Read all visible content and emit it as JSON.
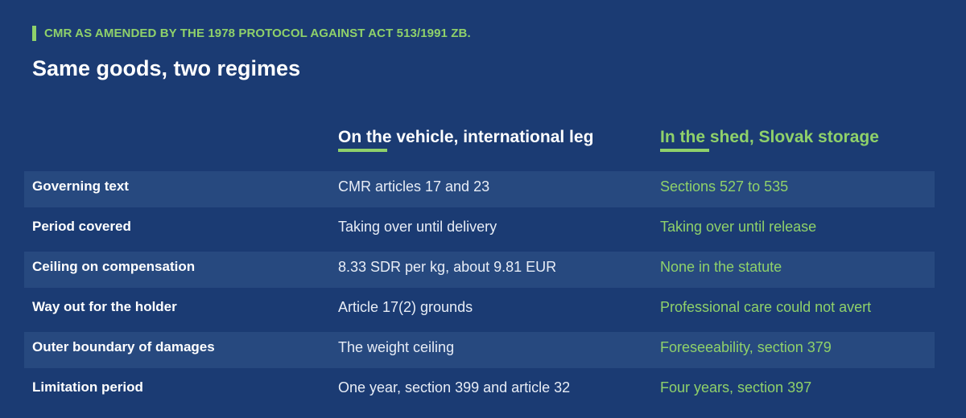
{
  "kicker": "CMR AS AMENDED BY THE 1978 PROTOCOL AGAINST ACT 513/1991 ZB.",
  "title": "Same goods, two regimes",
  "columns": {
    "vehicle": "On the vehicle, international leg",
    "shed": "In the shed, Slovak storage"
  },
  "colors": {
    "background": "#1b3b73",
    "row_shade": "#27497f",
    "accent": "#8fd16a"
  },
  "rows": [
    {
      "label": "Governing text",
      "vehicle": "CMR articles 17 and 23",
      "shed": "Sections 527 to 535"
    },
    {
      "label": "Period covered",
      "vehicle": "Taking over until delivery",
      "shed": "Taking over until release"
    },
    {
      "label": "Ceiling on compensation",
      "vehicle": "8.33 SDR per kg, about 9.81 EUR",
      "shed": "None in the statute"
    },
    {
      "label": "Way out for the holder",
      "vehicle": "Article 17(2) grounds",
      "shed": "Professional care could not avert"
    },
    {
      "label": "Outer boundary of damages",
      "vehicle": "The weight ceiling",
      "shed": "Foreseeability, section 379"
    },
    {
      "label": "Limitation period",
      "vehicle": "One year, section 399 and article 32",
      "shed": "Four years, section 397"
    }
  ]
}
